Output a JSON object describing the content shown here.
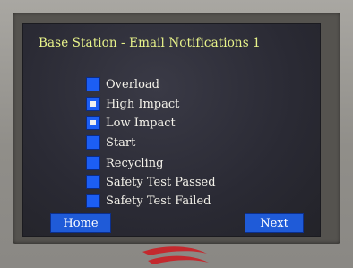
{
  "screen": {
    "title": "Base Station - Email Notifications 1"
  },
  "notifications": [
    {
      "label": "Overload",
      "checked": true
    },
    {
      "label": "High Impact",
      "checked": false
    },
    {
      "label": "Low Impact",
      "checked": false
    },
    {
      "label": "Start",
      "checked": true
    },
    {
      "label": "Recycling",
      "checked": true
    },
    {
      "label": "Safety Test Passed",
      "checked": true
    },
    {
      "label": "Safety Test Failed",
      "checked": true
    }
  ],
  "footer": {
    "home_label": "Home",
    "next_label": "Next"
  },
  "colors": {
    "title": "#e8f38a",
    "checkbox": "#1c5ef4",
    "button": "#1f5bd8",
    "logo": "#c4292e"
  },
  "icons": {
    "brand": "red-swoosh-logo-icon"
  }
}
